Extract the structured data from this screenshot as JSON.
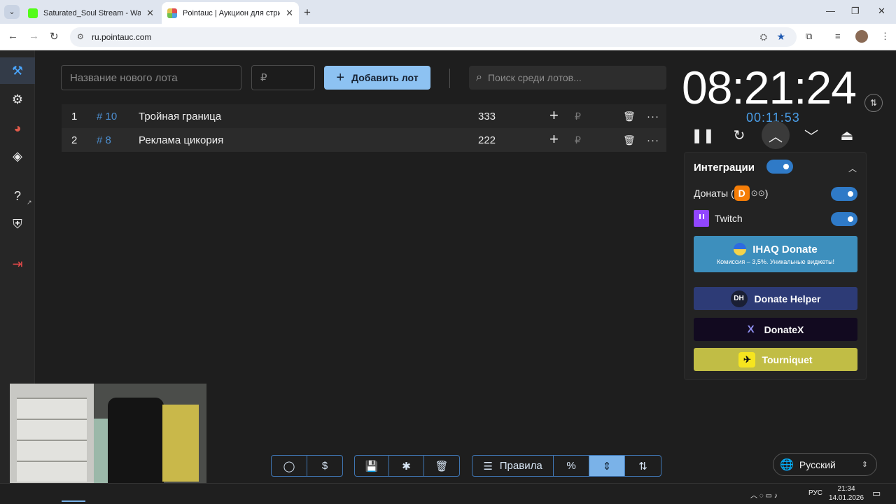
{
  "browser": {
    "tabs": [
      {
        "title": "Saturated_Soul Stream - Watch",
        "color": "#53fc18",
        "active": false
      },
      {
        "title": "Pointauc | Аукцион для стримеров",
        "color": "#e04e4e",
        "active": true
      }
    ],
    "url": "ru.pointauc.com"
  },
  "sidebar": {
    "items": [
      {
        "icon": "gavel-icon",
        "glyph": "⚒"
      },
      {
        "icon": "gear-icon",
        "glyph": "⚙"
      },
      {
        "icon": "wheel-icon",
        "glyph": "◕"
      },
      {
        "icon": "layers-icon",
        "glyph": "◈"
      },
      {
        "icon": "help-icon",
        "glyph": "?"
      },
      {
        "icon": "shield-icon",
        "glyph": "⛨"
      },
      {
        "icon": "logout-icon",
        "glyph": "⇥"
      }
    ],
    "external_glyph": "↗"
  },
  "toolbar": {
    "lot_name_placeholder": "Название нового лота",
    "amount_placeholder": "₽",
    "add_label": "Добавить лот",
    "add_glyph": "+",
    "search_placeholder": "Поиск среди лотов...",
    "search_glyph": "⌕"
  },
  "lots": [
    {
      "index": "1",
      "id": "# 10",
      "name": "Тройная граница",
      "amount": "333",
      "currency": "₽"
    },
    {
      "index": "2",
      "id": "# 8",
      "name": "Реклама цикория",
      "amount": "222",
      "currency": "₽"
    }
  ],
  "lot_actions": {
    "plus": "+",
    "trash": "🗑",
    "more": "···"
  },
  "timer": {
    "main": "08:21:24",
    "sub": "00:11:53",
    "swap_glyph": "⇅",
    "controls": [
      {
        "icon": "pause-icon",
        "glyph": "❚❚"
      },
      {
        "icon": "restart-icon",
        "glyph": "↻"
      },
      {
        "icon": "chevron-up-icon",
        "glyph": "︿"
      },
      {
        "icon": "chevron-down-icon",
        "glyph": "﹀"
      },
      {
        "icon": "eject-icon",
        "glyph": "⏏"
      }
    ]
  },
  "integrations": {
    "title": "Интеграции",
    "enabled": true,
    "collapse_glyph": "︿",
    "donats_label": "Донаты (",
    "donats_suffix": ")",
    "donats_logo": "D",
    "donats_eyes": "⊙⊙",
    "twitch_label": "Twitch",
    "ihaq": {
      "title": "IHAQ Donate",
      "subtitle": "Комиссия – 3,5%. Уникальные виджеты!"
    },
    "donate_helper": {
      "label": "Donate Helper",
      "icon_text": "DH"
    },
    "donatex": {
      "label": "DonateX",
      "icon_text": "X"
    },
    "tourniquet": {
      "label": "Tourniquet",
      "icon_text": "✈"
    }
  },
  "bottom": {
    "github_glyph": "◯",
    "dollar_glyph": "$",
    "save_glyph": "💾",
    "bug_glyph": "✱",
    "clear_glyph": "🗑",
    "rules_label": "Правила",
    "rules_glyph": "☰",
    "percent_glyph": "%",
    "compress_glyph": "⇕",
    "sort_glyph": "⇅"
  },
  "language": {
    "label": "Русский",
    "globe": "🌐",
    "arrow": "⇕"
  },
  "taskbar": {
    "time": "21:34",
    "date": "14.01.2026",
    "lang": "РУС",
    "tray_glyphs": "︿  ◌  ▭  ♪"
  },
  "colors": {
    "accent": "#4a9ee8",
    "toggle": "#2f7ac7",
    "ihaq": "#3d8fbd",
    "donate_helper": "#2d3b76",
    "donatex": "#120a20",
    "tourniquet": "#c1bd45"
  }
}
